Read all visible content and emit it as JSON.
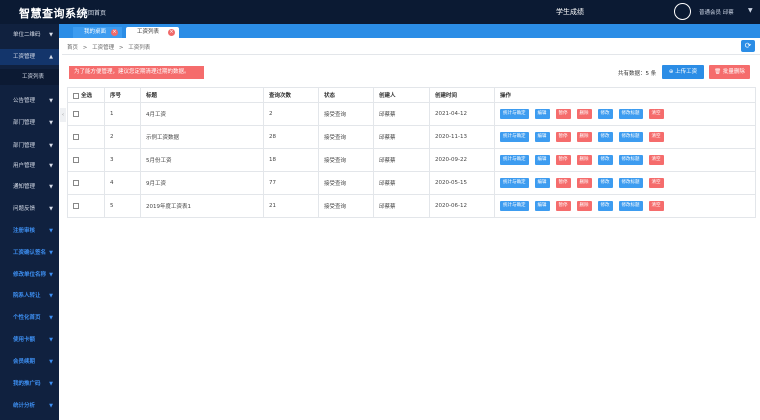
{
  "header": {
    "app_title": "智慧查询系统",
    "back_home": "返回首页",
    "center_title": "学生成绩",
    "user_info": "普通会员 邱蔡"
  },
  "sidebar": {
    "items": [
      {
        "label": "单位二维码"
      },
      {
        "label": "工资管理"
      },
      {
        "label": "工资列表"
      },
      {
        "label": "公告管理"
      },
      {
        "label": "部门管理"
      },
      {
        "label": "部门管理"
      },
      {
        "label": "用户管理"
      },
      {
        "label": "通知管理"
      },
      {
        "label": "问题反馈"
      },
      {
        "label": "注册审核"
      },
      {
        "label": "工资确认签名"
      },
      {
        "label": "修改单位名称"
      },
      {
        "label": "院系人转让"
      },
      {
        "label": "个性化首页"
      },
      {
        "label": "使用卡额"
      },
      {
        "label": "会员续期"
      },
      {
        "label": "我的推广码"
      },
      {
        "label": "统计分析"
      }
    ]
  },
  "tabs": [
    {
      "label": "我的桌面"
    },
    {
      "label": "工资列表"
    }
  ],
  "breadcrumb": {
    "home": "首页",
    "sep": ">",
    "level1": "工资管理",
    "level2": "工资列表"
  },
  "toolbar": {
    "warning": "为了能方便管理，建议您定期清理过期的数据。",
    "total_label": "共有数据：",
    "total_value": "5 条",
    "upload_label": "上传工资",
    "batch_delete_label": "批量删除"
  },
  "table": {
    "columns": [
      "全选",
      "序号",
      "标题",
      "查询次数",
      "状态",
      "创建人",
      "创建时间",
      "操作"
    ],
    "rows": [
      {
        "index": "1",
        "title": "4月工资",
        "count": "2",
        "status": "接受查询",
        "creator": "邱蔡蔡",
        "created": "2021-04-12"
      },
      {
        "index": "2",
        "title": "示例工资数据",
        "count": "28",
        "status": "接受查询",
        "creator": "邱蔡蔡",
        "created": "2020-11-13"
      },
      {
        "index": "3",
        "title": "5月份工资",
        "count": "18",
        "status": "接受查询",
        "creator": "邱蔡蔡",
        "created": "2020-09-22"
      },
      {
        "index": "4",
        "title": "9月工资",
        "count": "77",
        "status": "接受查询",
        "creator": "邱蔡蔡",
        "created": "2020-05-15"
      },
      {
        "index": "5",
        "title": "2019年度工资表1",
        "count": "21",
        "status": "接受查询",
        "creator": "邱蔡蔡",
        "created": "2020-06-12"
      }
    ],
    "actions": [
      "统计与确定",
      "编辑",
      "暂停",
      "删除",
      "修改",
      "修改标题",
      "清空"
    ]
  },
  "colors": {
    "topbar": "#0b1a33",
    "sidebar": "#10213f",
    "accent": "#2b8de6",
    "danger": "#f56c6c"
  }
}
